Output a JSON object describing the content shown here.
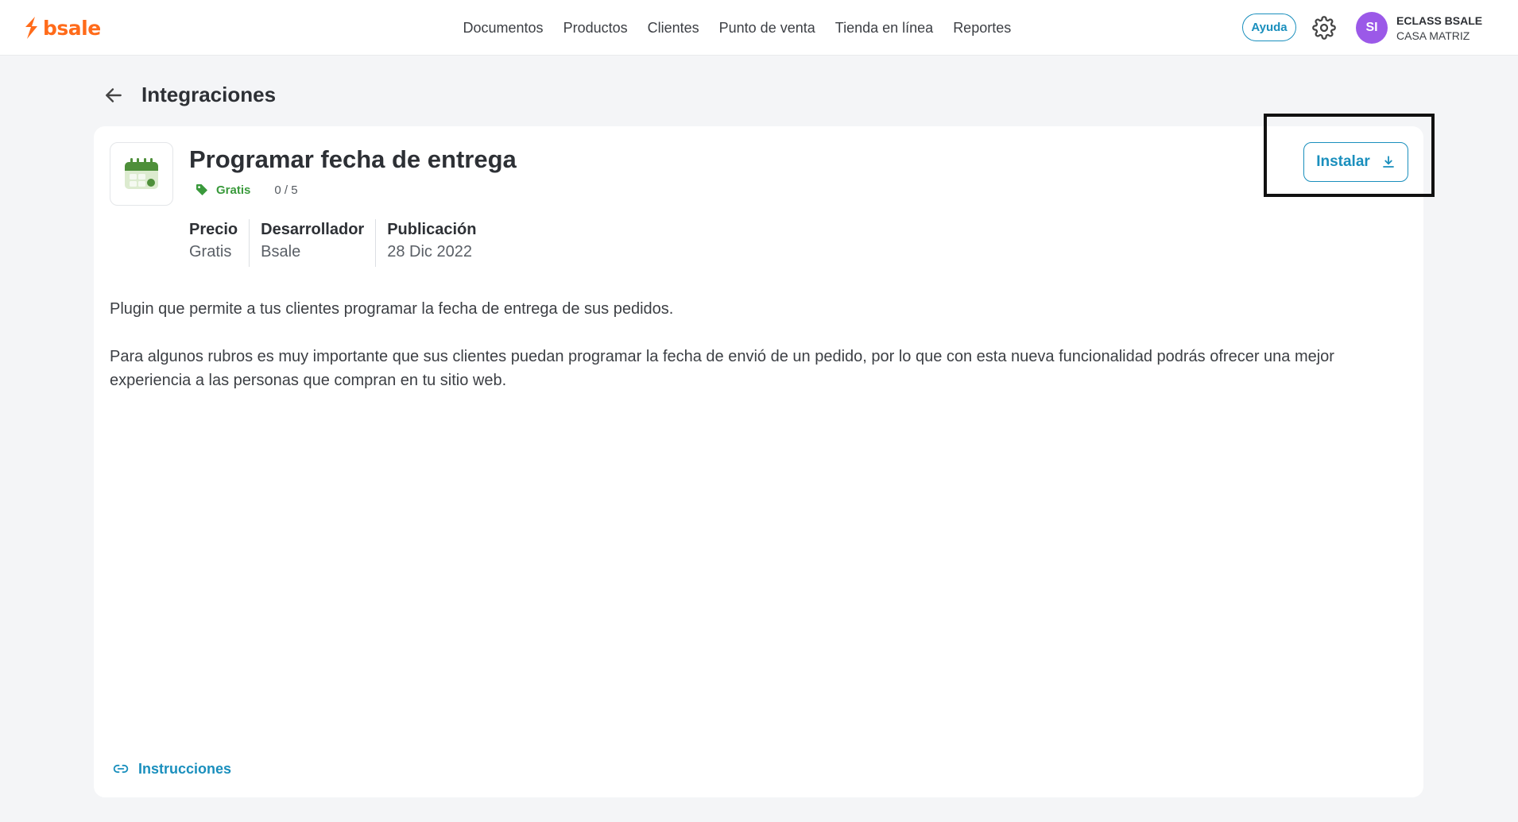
{
  "brand": {
    "name": "bsale",
    "color": "#ff6b1a"
  },
  "nav": {
    "items": [
      {
        "label": "Documentos"
      },
      {
        "label": "Productos"
      },
      {
        "label": "Clientes"
      },
      {
        "label": "Punto de venta"
      },
      {
        "label": "Tienda en línea"
      },
      {
        "label": "Reportes"
      }
    ]
  },
  "header": {
    "help_label": "Ayuda",
    "settings_icon": "gear-icon",
    "avatar_initials": "SI",
    "account_name": "ECLASS BSALE",
    "account_branch": "CASA MATRIZ"
  },
  "page": {
    "title": "Integraciones",
    "back_icon": "arrow-left-icon"
  },
  "app": {
    "icon": "calendar-icon",
    "title": "Programar fecha de entrega",
    "price_tag": "Gratis",
    "rating": "0 / 5",
    "install_label": "Instalar",
    "install_icon": "download-icon",
    "info": [
      {
        "head": "Precio",
        "value": "Gratis"
      },
      {
        "head": "Desarrollador",
        "value": "Bsale"
      },
      {
        "head": "Publicación",
        "value": "28 Dic 2022"
      }
    ],
    "description": [
      "Plugin que permite a tus clientes programar la fecha de entrega de sus pedidos.",
      "Para algunos rubros es muy importante que sus clientes puedan programar la fecha de envió de un pedido, por lo que con esta nueva funcionalidad podrás ofrecer una mejor experiencia a las personas que compran en tu sitio web."
    ],
    "instructions_label": "Instrucciones"
  },
  "colors": {
    "accent": "#1a8fbd",
    "tag_green": "#3a9a3c",
    "avatar": "#9b59e8"
  }
}
